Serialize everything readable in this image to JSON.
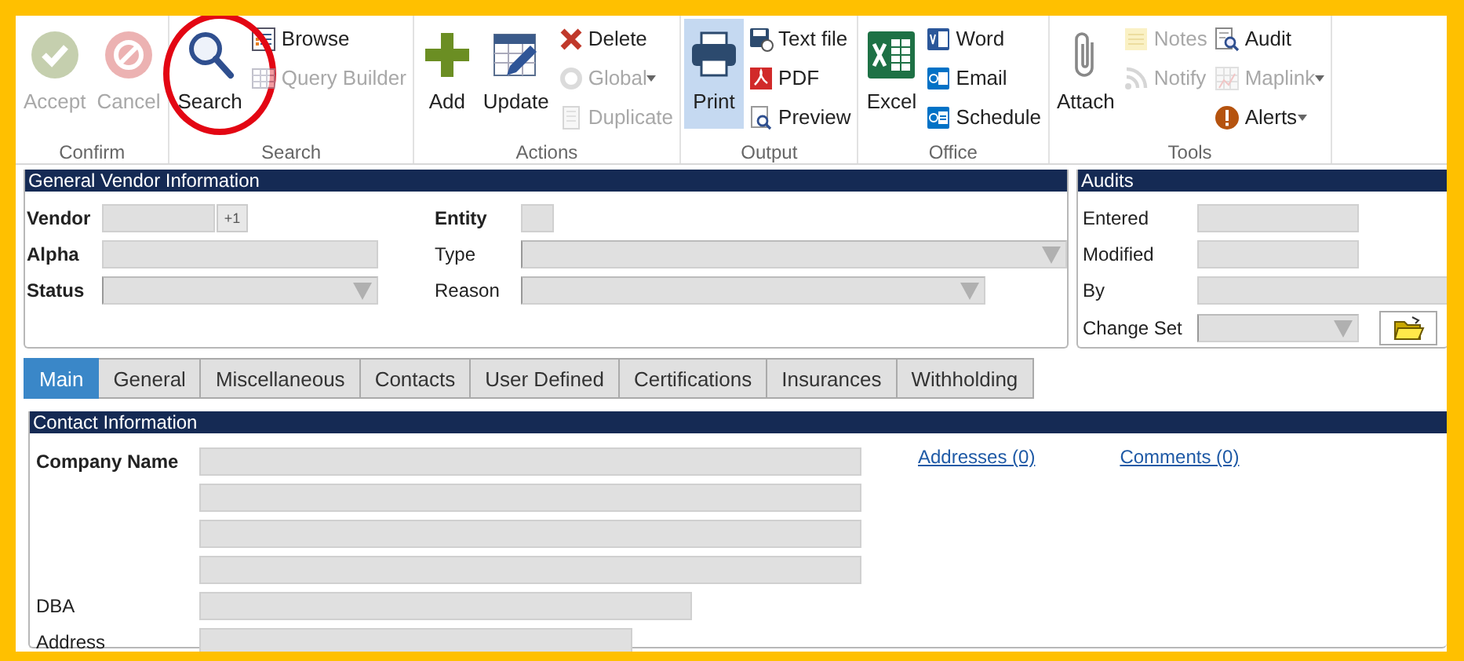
{
  "ribbon": {
    "groups": [
      {
        "label": "Confirm",
        "columns": [
          [
            {
              "label": "Accept",
              "kind": "large",
              "disabled": true
            }
          ],
          [
            {
              "label": "Cancel",
              "kind": "large",
              "disabled": true
            }
          ]
        ]
      },
      {
        "label": "Search",
        "columns": [
          [
            {
              "label": "Search",
              "kind": "large",
              "disabled": false,
              "highlighted": true
            }
          ],
          [
            {
              "label": "Browse",
              "kind": "small",
              "disabled": false
            },
            {
              "label": "Query Builder",
              "kind": "small",
              "disabled": true
            }
          ]
        ]
      },
      {
        "label": "Actions",
        "columns": [
          [
            {
              "label": "Add",
              "kind": "large",
              "disabled": false
            }
          ],
          [
            {
              "label": "Update",
              "kind": "large",
              "disabled": false
            }
          ],
          [
            {
              "label": "Delete",
              "kind": "small",
              "disabled": false
            },
            {
              "label": "Global",
              "kind": "small",
              "disabled": true,
              "dropdown": true
            },
            {
              "label": "Duplicate",
              "kind": "small",
              "disabled": true
            }
          ]
        ]
      },
      {
        "label": "Output",
        "columns": [
          [
            {
              "label": "Print",
              "kind": "large",
              "disabled": false,
              "selected": true
            }
          ],
          [
            {
              "label": "Text file",
              "kind": "small",
              "disabled": false
            },
            {
              "label": "PDF",
              "kind": "small",
              "disabled": false
            },
            {
              "label": "Preview",
              "kind": "small",
              "disabled": false
            }
          ]
        ]
      },
      {
        "label": "Office",
        "columns": [
          [
            {
              "label": "Excel",
              "kind": "large",
              "disabled": false
            }
          ],
          [
            {
              "label": "Word",
              "kind": "small",
              "disabled": false
            },
            {
              "label": "Email",
              "kind": "small",
              "disabled": false
            },
            {
              "label": "Schedule",
              "kind": "small",
              "disabled": false
            }
          ]
        ]
      },
      {
        "label": "Tools",
        "columns": [
          [
            {
              "label": "Attach",
              "kind": "large",
              "disabled": false
            }
          ],
          [
            {
              "label": "Notes",
              "kind": "small",
              "disabled": true
            },
            {
              "label": "Notify",
              "kind": "small",
              "disabled": true
            }
          ],
          [
            {
              "label": "Audit",
              "kind": "small",
              "disabled": false
            },
            {
              "label": "Maplink",
              "kind": "small",
              "disabled": true,
              "dropdown": true
            },
            {
              "label": "Alerts",
              "kind": "small",
              "disabled": false,
              "dropdown": true
            }
          ]
        ]
      }
    ]
  },
  "vendor_info": {
    "title": "General Vendor Information",
    "columns": [
      [
        {
          "label": "Vendor",
          "required": true,
          "kind": "text_counter",
          "button": "+1"
        },
        {
          "label": "Alpha",
          "required": true,
          "kind": "text"
        },
        {
          "label": "Status",
          "required": true,
          "kind": "select"
        }
      ],
      [
        {
          "label": "Entity",
          "required": true,
          "kind": "text"
        },
        {
          "label": "Type",
          "required": false,
          "kind": "select"
        },
        {
          "label": "Reason",
          "required": false,
          "kind": "select"
        }
      ]
    ]
  },
  "audits": {
    "title": "Audits",
    "fields": [
      {
        "label": "Entered",
        "required": false,
        "kind": "text"
      },
      {
        "label": "Modified",
        "required": false,
        "kind": "text"
      },
      {
        "label": "By",
        "required": false,
        "kind": "text"
      },
      {
        "label": "Change Set",
        "required": false,
        "kind": "select_browse"
      }
    ]
  },
  "tabs": [
    {
      "label": "Main",
      "selected": true
    },
    {
      "label": "General",
      "selected": false
    },
    {
      "label": "Miscellaneous",
      "selected": false
    },
    {
      "label": "Contacts",
      "selected": false
    },
    {
      "label": "User Defined",
      "selected": false
    },
    {
      "label": "Certifications",
      "selected": false
    },
    {
      "label": "Insurances",
      "selected": false
    },
    {
      "label": "Withholding",
      "selected": false
    }
  ],
  "contact_info": {
    "title": "Contact Information",
    "rows": [
      {
        "label": "Company Name",
        "required": true,
        "kind": "text"
      },
      {
        "kind": "text"
      },
      {
        "kind": "text"
      },
      {
        "kind": "text"
      },
      {
        "label": "DBA",
        "required": false,
        "kind": "text"
      },
      {
        "label": "Address",
        "required": false,
        "kind": "text"
      }
    ],
    "links": [
      "Addresses (0)",
      "Comments (0)"
    ]
  }
}
